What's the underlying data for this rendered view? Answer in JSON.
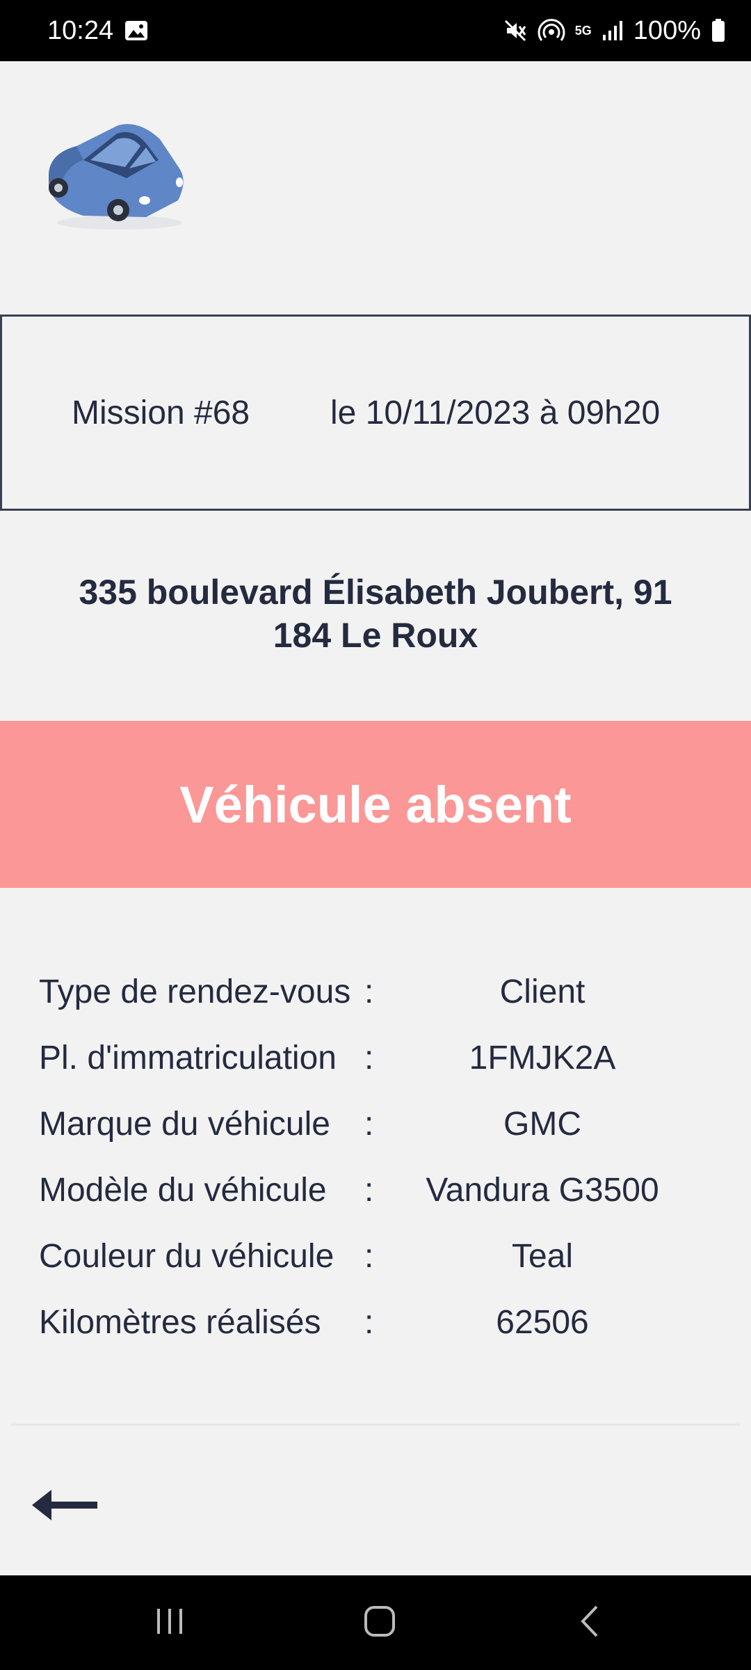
{
  "status_bar": {
    "time": "10:24",
    "battery": "100%",
    "network": "5G",
    "icons": [
      "gallery-icon",
      "mute-icon",
      "hotspot-icon",
      "5g-icon",
      "signal-icon",
      "battery-icon"
    ]
  },
  "mission": {
    "number": "Mission #68",
    "date": "le 10/11/2023 à 09h20"
  },
  "address": "335 boulevard Élisabeth Joubert, 91 184 Le Roux",
  "status_banner": {
    "label": "Véhicule absent",
    "color": "#fb9796"
  },
  "details": [
    {
      "label": "Type de rendez-vous",
      "sep": ":",
      "value": "Client"
    },
    {
      "label": "Pl. d'immatriculation",
      "sep": ":",
      "value": "1FMJK2A"
    },
    {
      "label": "Marque du véhicule",
      "sep": ":",
      "value": "GMC"
    },
    {
      "label": "Modèle du véhicule",
      "sep": ":",
      "value": "Vandura G3500"
    },
    {
      "label": "Couleur du véhicule",
      "sep": ":",
      "value": "Teal"
    },
    {
      "label": "Kilomètres réalisés",
      "sep": ":",
      "value": "62506"
    }
  ],
  "logo": {
    "name": "car-icon",
    "color": "#5f86c6"
  },
  "navigation": {
    "back": "back-arrow-icon"
  },
  "system_nav": [
    "recent-apps-icon",
    "home-icon",
    "back-icon"
  ]
}
